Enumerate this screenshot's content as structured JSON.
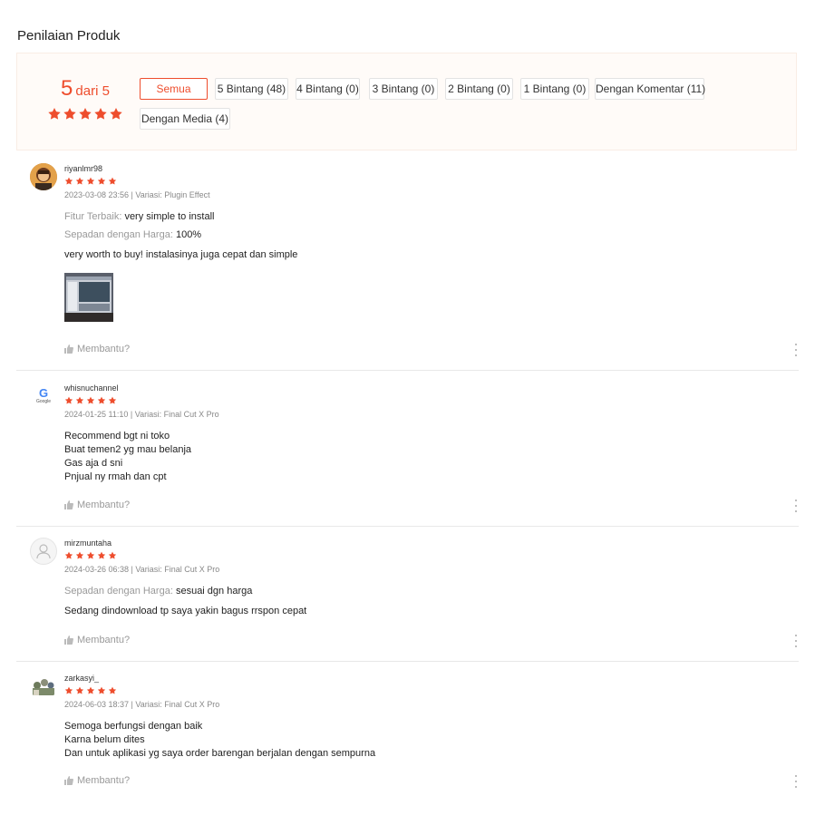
{
  "section_title": "Penilaian Produk",
  "overview": {
    "score": "5",
    "score_suffix": "dari 5",
    "rating": 5,
    "accent_color": "#ee4d2d",
    "filters": [
      {
        "label": "Semua",
        "active": true
      },
      {
        "label": "5 Bintang (48)",
        "active": false
      },
      {
        "label": "4 Bintang (0)",
        "active": false
      },
      {
        "label": "3 Bintang (0)",
        "active": false
      },
      {
        "label": "2 Bintang (0)",
        "active": false
      },
      {
        "label": "1 Bintang (0)",
        "active": false
      },
      {
        "label": "Dengan Komentar (11)",
        "active": false
      },
      {
        "label": "Dengan Media (4)",
        "active": false
      }
    ]
  },
  "reviews": [
    {
      "username": "riyanlmr98",
      "rating": 5,
      "meta": "2023-03-08 23:56 | Variasi: Plugin Effect",
      "attrs": [
        {
          "key": "Fitur Terbaik:",
          "value": "very simple to install"
        },
        {
          "key": "Sepadan dengan Harga:",
          "value": "100%"
        }
      ],
      "content": [
        "very worth to buy! instalasinya juga cepat dan simple"
      ],
      "helpful": "Membantu?",
      "avatar": "photo-avatar",
      "has_media": true
    },
    {
      "username": "whisnuchannel",
      "rating": 5,
      "meta": "2024-01-25 11:10 | Variasi: Final Cut X Pro",
      "attrs": [],
      "content": [
        "Recommend bgt ni toko",
        "Buat temen2 yg mau belanja",
        "Gas aja d sni",
        "Pnjual ny rmah dan cpt"
      ],
      "helpful": "Membantu?",
      "avatar": "google-logo-avatar",
      "avatar_text": "G",
      "avatar_caption": "Google",
      "has_media": false
    },
    {
      "username": "mirzmuntaha",
      "rating": 5,
      "meta": "2024-03-26 06:38 | Variasi: Final Cut X Pro",
      "attrs": [
        {
          "key": "Sepadan dengan Harga:",
          "value": "sesuai dgn harga"
        }
      ],
      "content": [
        "Sedang dindownload tp saya yakin bagus rrspon cepat"
      ],
      "helpful": "Membantu?",
      "avatar": "default-user-avatar",
      "has_media": false
    },
    {
      "username": "zarkasyi_",
      "rating": 5,
      "meta": "2024-06-03 18:37 | Variasi: Final Cut X Pro",
      "attrs": [],
      "content": [
        "Semoga berfungsi dengan baik",
        "Karna belum dites",
        "Dan untuk aplikasi yg saya order barengan berjalan dengan sempurna"
      ],
      "helpful": "Membantu?",
      "avatar": "group-photo-avatar",
      "has_media": false
    }
  ]
}
